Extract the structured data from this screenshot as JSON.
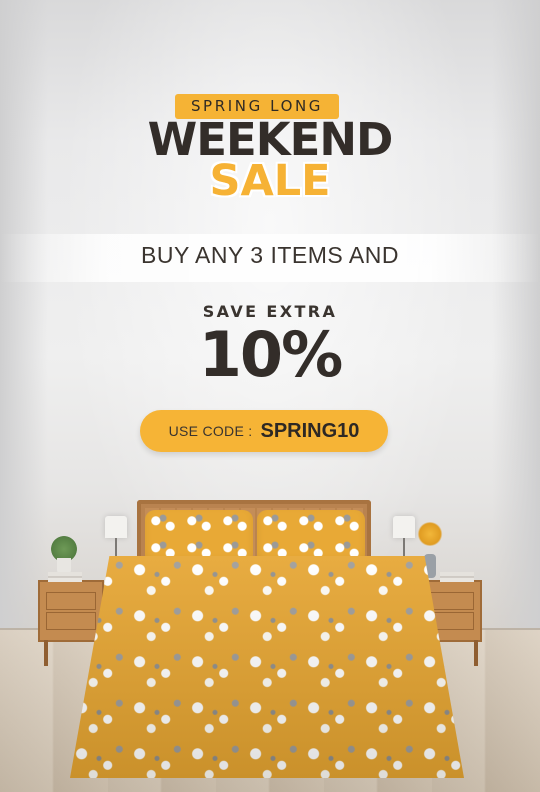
{
  "promo": {
    "tagline": "SPRING LONG",
    "headline": "WEEKEND",
    "subheadline": "SALE",
    "offer_line": "BUY ANY 3 ITEMS AND",
    "save_label": "SAVE EXTRA",
    "discount": "10%",
    "code_label": "USE CODE :",
    "code": "SPRING10"
  },
  "colors": {
    "accent": "#f6b436",
    "text_dark": "#332d29",
    "duvet": "#e6a531"
  }
}
